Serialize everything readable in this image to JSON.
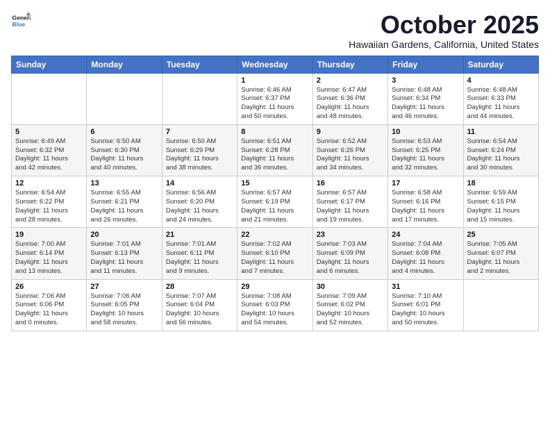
{
  "logo": {
    "line1": "General",
    "line2": "Blue"
  },
  "title": "October 2025",
  "location": "Hawaiian Gardens, California, United States",
  "weekdays": [
    "Sunday",
    "Monday",
    "Tuesday",
    "Wednesday",
    "Thursday",
    "Friday",
    "Saturday"
  ],
  "weeks": [
    [
      {
        "day": "",
        "info": ""
      },
      {
        "day": "",
        "info": ""
      },
      {
        "day": "",
        "info": ""
      },
      {
        "day": "1",
        "info": "Sunrise: 6:46 AM\nSunset: 6:37 PM\nDaylight: 11 hours\nand 50 minutes."
      },
      {
        "day": "2",
        "info": "Sunrise: 6:47 AM\nSunset: 6:36 PM\nDaylight: 11 hours\nand 48 minutes."
      },
      {
        "day": "3",
        "info": "Sunrise: 6:48 AM\nSunset: 6:34 PM\nDaylight: 11 hours\nand 46 minutes."
      },
      {
        "day": "4",
        "info": "Sunrise: 6:48 AM\nSunset: 6:33 PM\nDaylight: 11 hours\nand 44 minutes."
      }
    ],
    [
      {
        "day": "5",
        "info": "Sunrise: 6:49 AM\nSunset: 6:32 PM\nDaylight: 11 hours\nand 42 minutes."
      },
      {
        "day": "6",
        "info": "Sunrise: 6:50 AM\nSunset: 6:30 PM\nDaylight: 11 hours\nand 40 minutes."
      },
      {
        "day": "7",
        "info": "Sunrise: 6:50 AM\nSunset: 6:29 PM\nDaylight: 11 hours\nand 38 minutes."
      },
      {
        "day": "8",
        "info": "Sunrise: 6:51 AM\nSunset: 6:28 PM\nDaylight: 11 hours\nand 36 minutes."
      },
      {
        "day": "9",
        "info": "Sunrise: 6:52 AM\nSunset: 6:26 PM\nDaylight: 11 hours\nand 34 minutes."
      },
      {
        "day": "10",
        "info": "Sunrise: 6:53 AM\nSunset: 6:25 PM\nDaylight: 11 hours\nand 32 minutes."
      },
      {
        "day": "11",
        "info": "Sunrise: 6:54 AM\nSunset: 6:24 PM\nDaylight: 11 hours\nand 30 minutes."
      }
    ],
    [
      {
        "day": "12",
        "info": "Sunrise: 6:54 AM\nSunset: 6:22 PM\nDaylight: 11 hours\nand 28 minutes."
      },
      {
        "day": "13",
        "info": "Sunrise: 6:55 AM\nSunset: 6:21 PM\nDaylight: 11 hours\nand 26 minutes."
      },
      {
        "day": "14",
        "info": "Sunrise: 6:56 AM\nSunset: 6:20 PM\nDaylight: 11 hours\nand 24 minutes."
      },
      {
        "day": "15",
        "info": "Sunrise: 6:57 AM\nSunset: 6:19 PM\nDaylight: 11 hours\nand 21 minutes."
      },
      {
        "day": "16",
        "info": "Sunrise: 6:57 AM\nSunset: 6:17 PM\nDaylight: 11 hours\nand 19 minutes."
      },
      {
        "day": "17",
        "info": "Sunrise: 6:58 AM\nSunset: 6:16 PM\nDaylight: 11 hours\nand 17 minutes."
      },
      {
        "day": "18",
        "info": "Sunrise: 6:59 AM\nSunset: 6:15 PM\nDaylight: 11 hours\nand 15 minutes."
      }
    ],
    [
      {
        "day": "19",
        "info": "Sunrise: 7:00 AM\nSunset: 6:14 PM\nDaylight: 11 hours\nand 13 minutes."
      },
      {
        "day": "20",
        "info": "Sunrise: 7:01 AM\nSunset: 6:13 PM\nDaylight: 11 hours\nand 11 minutes."
      },
      {
        "day": "21",
        "info": "Sunrise: 7:01 AM\nSunset: 6:11 PM\nDaylight: 11 hours\nand 9 minutes."
      },
      {
        "day": "22",
        "info": "Sunrise: 7:02 AM\nSunset: 6:10 PM\nDaylight: 11 hours\nand 7 minutes."
      },
      {
        "day": "23",
        "info": "Sunrise: 7:03 AM\nSunset: 6:09 PM\nDaylight: 11 hours\nand 6 minutes."
      },
      {
        "day": "24",
        "info": "Sunrise: 7:04 AM\nSunset: 6:08 PM\nDaylight: 11 hours\nand 4 minutes."
      },
      {
        "day": "25",
        "info": "Sunrise: 7:05 AM\nSunset: 6:07 PM\nDaylight: 11 hours\nand 2 minutes."
      }
    ],
    [
      {
        "day": "26",
        "info": "Sunrise: 7:06 AM\nSunset: 6:06 PM\nDaylight: 11 hours\nand 0 minutes."
      },
      {
        "day": "27",
        "info": "Sunrise: 7:06 AM\nSunset: 6:05 PM\nDaylight: 10 hours\nand 58 minutes."
      },
      {
        "day": "28",
        "info": "Sunrise: 7:07 AM\nSunset: 6:04 PM\nDaylight: 10 hours\nand 56 minutes."
      },
      {
        "day": "29",
        "info": "Sunrise: 7:08 AM\nSunset: 6:03 PM\nDaylight: 10 hours\nand 54 minutes."
      },
      {
        "day": "30",
        "info": "Sunrise: 7:09 AM\nSunset: 6:02 PM\nDaylight: 10 hours\nand 52 minutes."
      },
      {
        "day": "31",
        "info": "Sunrise: 7:10 AM\nSunset: 6:01 PM\nDaylight: 10 hours\nand 50 minutes."
      },
      {
        "day": "",
        "info": ""
      }
    ]
  ]
}
